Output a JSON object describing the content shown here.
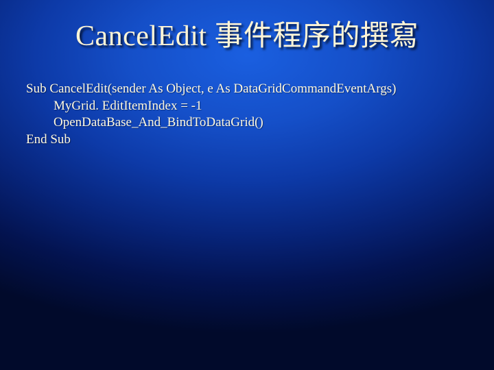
{
  "title": "CancelEdit  事件程序的撰寫",
  "code": {
    "line1": "Sub CancelEdit(sender As Object, e As DataGridCommandEventArgs)",
    "line2": "MyGrid. EditItemIndex = -1",
    "line3": "OpenDataBase_And_BindToDataGrid()",
    "line4": "End Sub"
  }
}
